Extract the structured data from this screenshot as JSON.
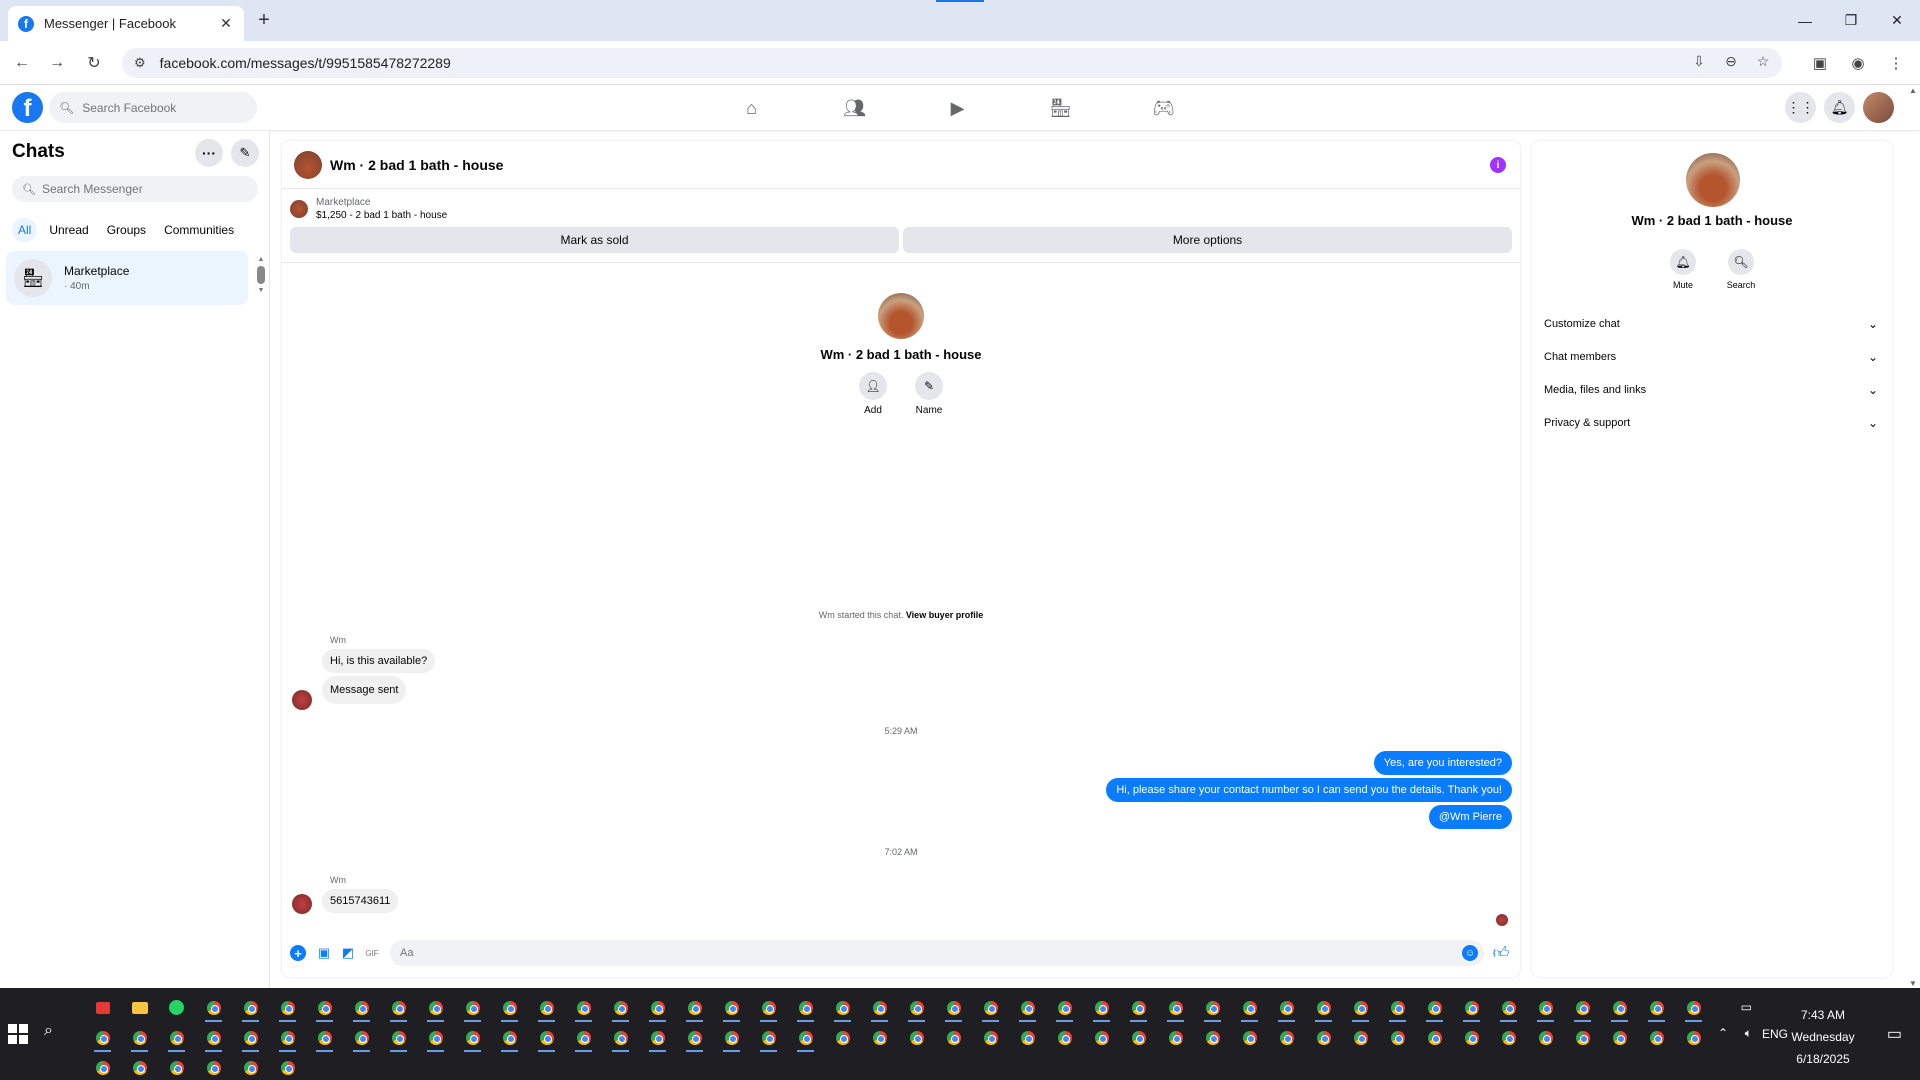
{
  "browser": {
    "tab_title": "Messenger | Facebook",
    "url": "facebook.com/messages/t/9951585478272289",
    "colors": {
      "tabbar": "#dfe6f3",
      "accent": "#1a73e8"
    }
  },
  "fb": {
    "search_placeholder": "Search Facebook",
    "brand_color": "#1877f2"
  },
  "chats": {
    "title": "Chats",
    "search_placeholder": "Search Messenger",
    "filters": [
      "All",
      "Unread",
      "Groups",
      "Communities"
    ],
    "items": [
      {
        "name": "Marketplace",
        "time": "· 40m"
      }
    ]
  },
  "conversation": {
    "title": "Wm · 2 bad 1 bath - house",
    "listing": {
      "label": "Marketplace",
      "price_title": "$1,250 - 2 bad 1 bath - house",
      "mark_sold": "Mark as sold",
      "more_options": "More options"
    },
    "profile": {
      "name": "Wm · 2 bad 1 bath - house",
      "actions": [
        "Add",
        "Name"
      ]
    },
    "started_text": "Wm started this chat.",
    "started_link": "View buyer profile",
    "messages": {
      "sender1": "Wm",
      "in1": "Hi, is this available?",
      "in2": "Message sent",
      "ts1": "5:29 AM",
      "out1": "Yes, are you interested?",
      "out2": "Hi, please share your contact number so I can send you the details. Thank you!",
      "out3": "@Wm Pierre",
      "ts2": "7:02 AM",
      "sender2": "Wm",
      "in3": "5615743611"
    },
    "composer_placeholder": "Aa",
    "colors": {
      "outgoing": "#0a7cff",
      "incoming": "#f0f0f0"
    }
  },
  "info_panel": {
    "name": "Wm · 2 bad 1 bath - house",
    "actions": [
      "Mute",
      "Search"
    ],
    "sections": [
      "Customize chat",
      "Chat members",
      "Media, files and links",
      "Privacy & support"
    ]
  },
  "taskbar": {
    "time": "7:43 AM",
    "day": "Wednesday",
    "date": "6/18/2025",
    "lang": "ENG"
  }
}
